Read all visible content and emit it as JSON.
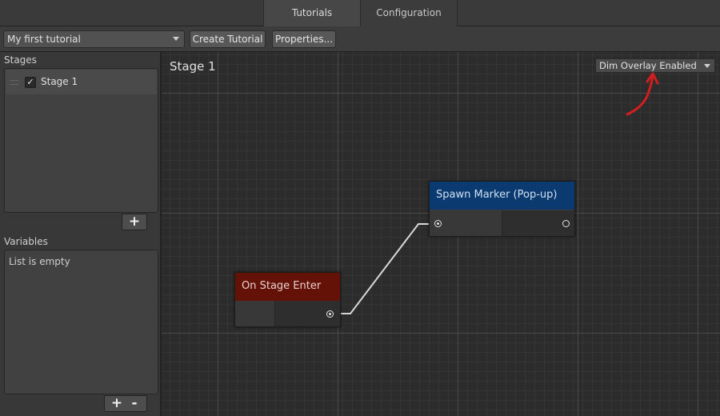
{
  "tabs": [
    {
      "label": "Tutorials",
      "active": true
    },
    {
      "label": "Configuration",
      "active": false
    }
  ],
  "toolbar": {
    "tutorial_select": "My first tutorial",
    "create_label": "Create Tutorial",
    "properties_label": "Properties..."
  },
  "stages": {
    "label": "Stages",
    "items": [
      {
        "label": "Stage 1",
        "checked": true
      }
    ],
    "add": "+"
  },
  "variables": {
    "label": "Variables",
    "empty_text": "List is empty",
    "add": "+",
    "remove": "-"
  },
  "canvas": {
    "title": "Stage 1",
    "overlay_select": "Dim Overlay Enabled",
    "nodes": {
      "enter": {
        "title": "On Stage Enter",
        "color": "#641107"
      },
      "spawn": {
        "title": "Spawn Marker (Pop-up)",
        "color": "#0b3a70"
      }
    },
    "annotation_color": "#d21e1e"
  }
}
